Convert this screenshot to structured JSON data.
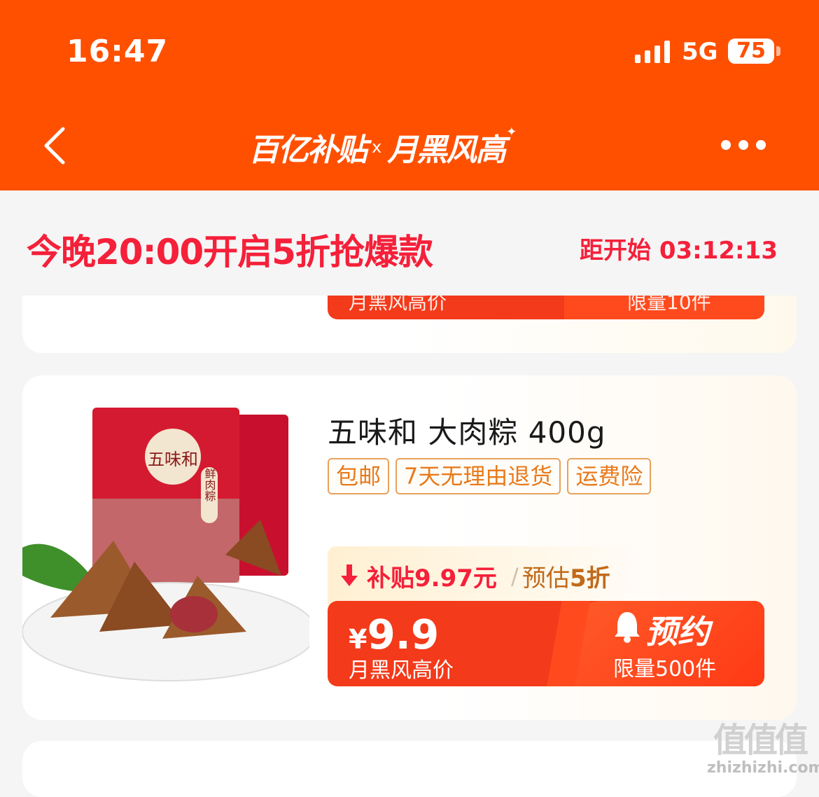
{
  "status_bar": {
    "time": "16:47",
    "network": "5G",
    "battery": "75"
  },
  "nav": {
    "title_left": "百亿补贴",
    "title_sep": "x",
    "title_right": "月黑风高"
  },
  "banner": {
    "title": "今晚20:00开启5折抢爆款",
    "countdown": "距开始 03:12:13"
  },
  "prev_card": {
    "price_label": "月黑风高价",
    "limit": "限量10件"
  },
  "product": {
    "title": "五味和 大肉粽 400g",
    "tags": [
      "包邮",
      "7天无理由退货",
      "运费险"
    ],
    "subsidy": "补贴9.97元",
    "divider": "/",
    "estimate_prefix": "预估",
    "estimate_value": "5折",
    "currency": "¥",
    "price": "9.9",
    "price_label": "月黑风高价",
    "reserve_label": "预约",
    "limit": "限量500件",
    "package_brand": "五味和",
    "package_flavor": "鲜肉粽"
  },
  "watermark": {
    "glyphs": "值值值",
    "site": "zhizhizhi.com"
  },
  "colors": {
    "header": "#ff5000",
    "accent_red": "#f5203a",
    "buy_bar": "#f33a1a",
    "tag_orange": "#e87a1c"
  }
}
